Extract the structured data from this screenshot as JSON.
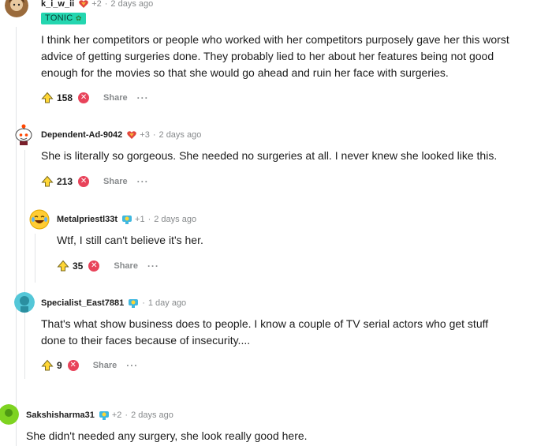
{
  "comments": [
    {
      "username": "k_i_w_ii",
      "karma": "+2",
      "time": "2 days ago",
      "flair": "TONIC",
      "text": "I think her competitors or people who worked with her competitors purposely gave her this worst advice of getting surgeries done. They probably lied to her about her features being not good enough for the movies so that she would go ahead and ruin her face with surgeries.",
      "votes": "158",
      "share": "Share",
      "more": "···"
    },
    {
      "username": "Dependent-Ad-9042",
      "karma": "+3",
      "time": "2 days ago",
      "text": "She is literally so gorgeous. She needed no surgeries at all. I never knew she looked like this.",
      "votes": "213",
      "share": "Share",
      "more": "···"
    },
    {
      "username": "Metalpriestl33t",
      "karma": "+1",
      "time": "2 days ago",
      "text": "Wtf, I still can't believe it's her.",
      "votes": "35",
      "share": "Share",
      "more": "···"
    },
    {
      "username": "Specialist_East7881",
      "time": "1 day ago",
      "text": "That's what show business does to people. I know a couple of TV serial actors who get stuff done to their faces because of insecurity....",
      "votes": "9",
      "share": "Share",
      "more": "···"
    },
    {
      "username": "Sakshisharma31",
      "karma": "+2",
      "time": "2 days ago",
      "text": "She didn't needed any surgery, she look really good here."
    }
  ],
  "sep": "·",
  "colors": {
    "tonic": "#24d6b0",
    "downvote": "#e8435a",
    "meta": "#878a8c",
    "thread": "#e2e4e7"
  }
}
